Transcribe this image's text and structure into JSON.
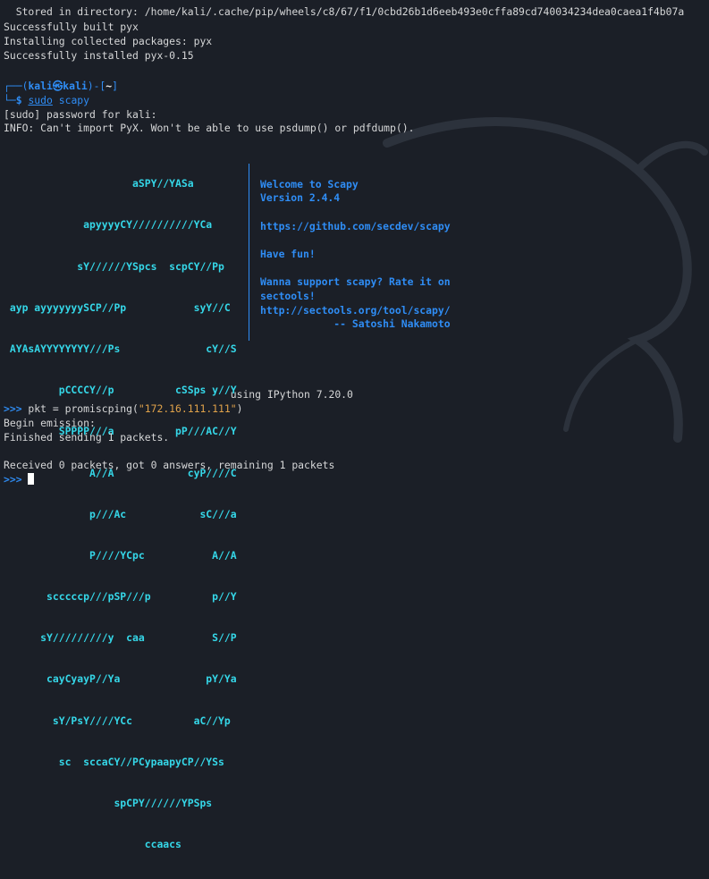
{
  "terminal": {
    "lines_top": [
      "  Stored in directory: /home/kali/.cache/pip/wheels/c8/67/f1/0cbd26b1d6eeb493e0cffa89cd740034234dea0caea1f4b07a",
      "Successfully built pyx",
      "Installing collected packages: pyx",
      "Successfully installed pyx-0.15"
    ],
    "prompt": {
      "user": "kali",
      "host": "kali",
      "dir": "~",
      "command_sudo": "sudo",
      "command_rest": " scapy"
    },
    "sudo_line": "[sudo] password for kali:",
    "info_line": "INFO: Can't import PyX. Won't be able to use psdump() or pdfdump().",
    "ascii_art": [
      "                     aSPY//YASa",
      "             apyyyyCY//////////YCa",
      "            sY//////YSpcs  scpCY//Pp",
      " ayp ayyyyyyySCP//Pp           syY//C",
      " AYAsAYYYYYYYY///Ps              cY//S",
      "         pCCCCY//p          cSSps y//Y",
      "         SPPPP///a          pP///AC//Y",
      "              A//A            cyP////C",
      "              p///Ac            sC///a",
      "              P////YCpc           A//A",
      "       scccccp///pSP///p          p//Y",
      "      sY/////////y  caa           S//P",
      "       cayCyayP//Ya              pY/Ya",
      "        sY/PsY////YCc          aC//Yp",
      "         sc  sccaCY//PCypaapyCP//YSs",
      "                  spCPY//////YPSps",
      "                       ccaacs"
    ],
    "welcome": {
      "line1": "Welcome to Scapy",
      "line2": "Version 2.4.4",
      "line3": "https://github.com/secdev/scapy",
      "line4": "Have fun!",
      "line5": "Wanna support scapy? Rate it on",
      "line6": "sectools!",
      "line7": "http://sectools.org/tool/scapy/",
      "line8": "            -- Satoshi Nakamoto"
    },
    "ipython_line": "                                     using IPython 7.20.0",
    "repl_prompt": ">>>",
    "cmd_pre": " pkt = promiscping(",
    "cmd_arg": "\"172.16.111.111\"",
    "cmd_post": ")",
    "begin_emission": "Begin emission:",
    "finished": "Finished sending 1 packets.",
    "received": "Received 0 packets, got 0 answers, remaining 1 packets",
    "final_prompt": ">>>"
  },
  "colors": {
    "background": "#1b1f27",
    "prompt_blue": "#2f8df5",
    "art_cyan": "#35d7e8",
    "string_orange": "#e0a24a"
  }
}
